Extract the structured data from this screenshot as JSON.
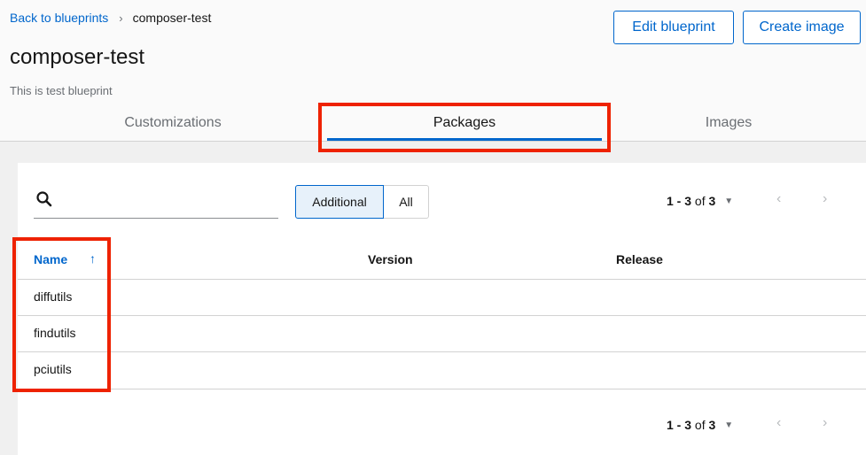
{
  "breadcrumb": {
    "back_label": "Back to blueprints",
    "separator": "›",
    "current": "composer-test"
  },
  "page": {
    "title": "composer-test",
    "description": "This is test blueprint"
  },
  "actions": {
    "edit_label": "Edit blueprint",
    "create_label": "Create image"
  },
  "tabs": [
    {
      "label": "Customizations",
      "selected": false
    },
    {
      "label": "Packages",
      "selected": true
    },
    {
      "label": "Images",
      "selected": false
    }
  ],
  "toolbar": {
    "search_placeholder": "",
    "toggle_additional": "Additional",
    "toggle_all": "All",
    "pagination": {
      "range": "1 - 3",
      "of_text": "of",
      "total": "3"
    }
  },
  "table": {
    "columns": {
      "name": "Name",
      "version": "Version",
      "release": "Release"
    },
    "sort_icon": "arrow-up-icon",
    "rows": [
      {
        "name": "diffutils",
        "version": "",
        "release": ""
      },
      {
        "name": "findutils",
        "version": "",
        "release": ""
      },
      {
        "name": "pciutils",
        "version": "",
        "release": ""
      }
    ]
  },
  "colors": {
    "link": "#0066cc",
    "annotation": "#ee2200",
    "selected_toggle_bg": "#e7f1fa"
  }
}
